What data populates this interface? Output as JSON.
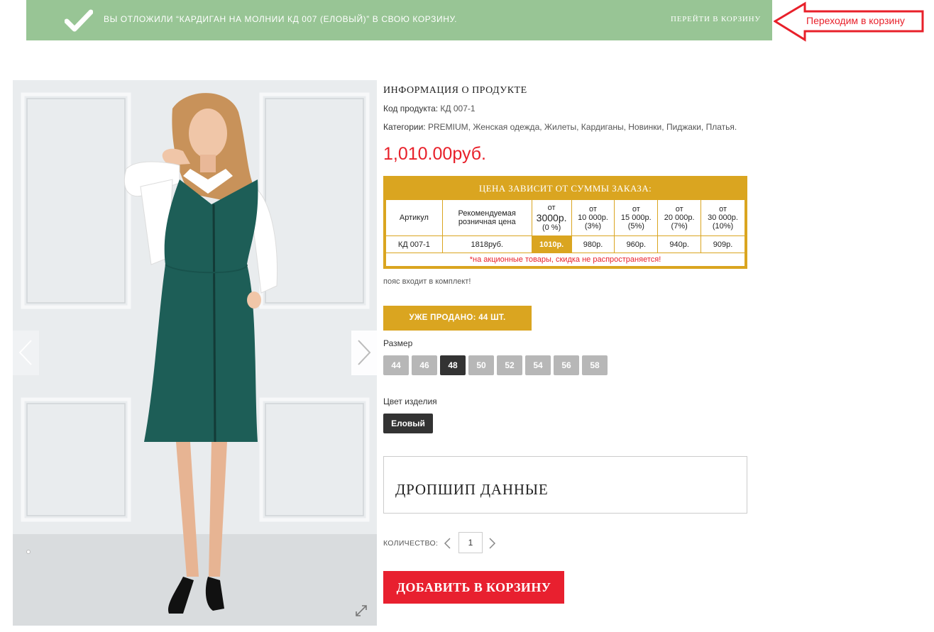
{
  "notice": {
    "message": "Вы отложили “Кардиган на молнии КД 007 (Еловый)” в свою корзину.",
    "view_cart": "Перейти в корзину"
  },
  "annotation": {
    "text": "Переходим в корзину",
    "color": "#e8202a"
  },
  "gallery": {
    "prev_icon": "chevron-left-icon",
    "next_icon": "chevron-right-icon",
    "zoom_icon": "expand-icon"
  },
  "product": {
    "info_title": "ИНФОРМАЦИЯ О ПРОДУКТЕ",
    "code_label": "Код продукта:",
    "code_value": "КД 007-1",
    "categories_label": "Категории:",
    "categories": [
      "PREMIUM",
      "Женская одежда",
      "Жилеты",
      "Кардиганы",
      "Новинки",
      "Пиджаки",
      "Платья"
    ],
    "price": "1,010.00руб.",
    "belt_note": "пояс входит в комплект!",
    "sold": "УЖЕ ПРОДАНО: 44 ШТ."
  },
  "price_table": {
    "title": "ЦЕНА ЗАВИСИТ ОТ СУММЫ ЗАКАЗА:",
    "headers": {
      "article": "Артикул",
      "retail_1": "Рекомендуемая",
      "retail_2": "розничная цена",
      "t1_a": "от",
      "t1_b": "3000р.",
      "t1_c": "(0 %)",
      "t2_a": "от",
      "t2_b": "10 000р.",
      "t2_c": "(3%)",
      "t3_a": "от",
      "t3_b": "15 000р.",
      "t3_c": "(5%)",
      "t4_a": "от",
      "t4_b": "20 000р.",
      "t4_c": "(7%)",
      "t5_a": "от",
      "t5_b": "30 000р.",
      "t5_c": "(10%)"
    },
    "row": {
      "article": "КД 007-1",
      "retail": "1818руб.",
      "p1": "1010р.",
      "p2": "980р.",
      "p3": "960р.",
      "p4": "940р.",
      "p5": "909р."
    },
    "note": "*на акционные товары, скидка не распространяется!",
    "accent": "#daa520"
  },
  "size": {
    "label": "Размер",
    "options": [
      "44",
      "46",
      "48",
      "50",
      "52",
      "54",
      "56",
      "58"
    ],
    "selected": "48"
  },
  "color": {
    "label": "Цвет изделия",
    "selected": "Еловый"
  },
  "dropship": {
    "title": "ДРОПШИП ДАННЫЕ"
  },
  "quantity": {
    "label": "КОЛИЧЕСТВО:",
    "value": "1"
  },
  "add_to_cart": "ДОБАВИТЬ В КОРЗИНУ",
  "colors": {
    "notice_bg": "#98c595",
    "price_red": "#e8202a",
    "button_red": "#e8202f",
    "dark": "#333333",
    "size_grey": "#b7b7b7"
  }
}
